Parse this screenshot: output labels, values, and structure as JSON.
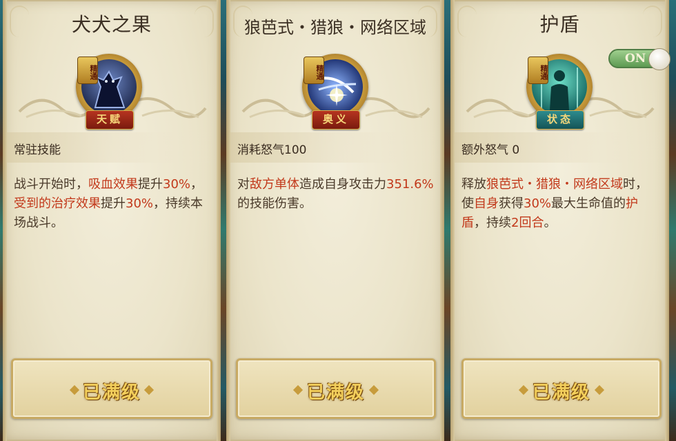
{
  "cards": [
    {
      "title": "犬犬之果",
      "top_tag": "精通",
      "type_tag": "天赋",
      "sublabel": "常驻技能",
      "desc_parts": [
        {
          "t": "战斗开始时，",
          "hl": false
        },
        {
          "t": "吸血效果",
          "hl": true
        },
        {
          "t": "提升",
          "hl": false
        },
        {
          "t": "30%",
          "hl": true
        },
        {
          "t": "，",
          "hl": false
        },
        {
          "t": "受到的治疗效果",
          "hl": true
        },
        {
          "t": "提升",
          "hl": false
        },
        {
          "t": "30%",
          "hl": true
        },
        {
          "t": "，持续本场战斗。",
          "hl": false
        }
      ],
      "button_label": "已满级",
      "icon": "werewolf-icon"
    },
    {
      "title": "狼芭式・猎狼・网络区域",
      "top_tag": "精通",
      "type_tag": "奥义",
      "sublabel": "消耗怒气100",
      "desc_parts": [
        {
          "t": "对",
          "hl": false
        },
        {
          "t": "敌方单体",
          "hl": true
        },
        {
          "t": "造成自身攻击力",
          "hl": false
        },
        {
          "t": "351.6%",
          "hl": true
        },
        {
          "t": "的技能伤害。",
          "hl": false
        }
      ],
      "button_label": "已满级",
      "icon": "slash-burst-icon"
    },
    {
      "title": "护盾",
      "top_tag": "精通",
      "type_tag": "状态",
      "sublabel": "额外怒气 0",
      "desc_parts": [
        {
          "t": "释放",
          "hl": false
        },
        {
          "t": "狼芭式・猎狼・网络区域",
          "hl": true
        },
        {
          "t": "时，使",
          "hl": false
        },
        {
          "t": "自身",
          "hl": true
        },
        {
          "t": "获得",
          "hl": false
        },
        {
          "t": "30%",
          "hl": true
        },
        {
          "t": "最大生命值的",
          "hl": false
        },
        {
          "t": "护盾",
          "hl": true
        },
        {
          "t": "，持续",
          "hl": false
        },
        {
          "t": "2回合",
          "hl": true
        },
        {
          "t": "。",
          "hl": false
        }
      ],
      "button_label": "已满级",
      "icon": "shield-aura-icon"
    }
  ],
  "toggle": {
    "label": "ON",
    "state": "on"
  },
  "colors": {
    "highlight": "#c2391b",
    "text": "#4a3a2a",
    "button_text": "#f3cf5c"
  }
}
